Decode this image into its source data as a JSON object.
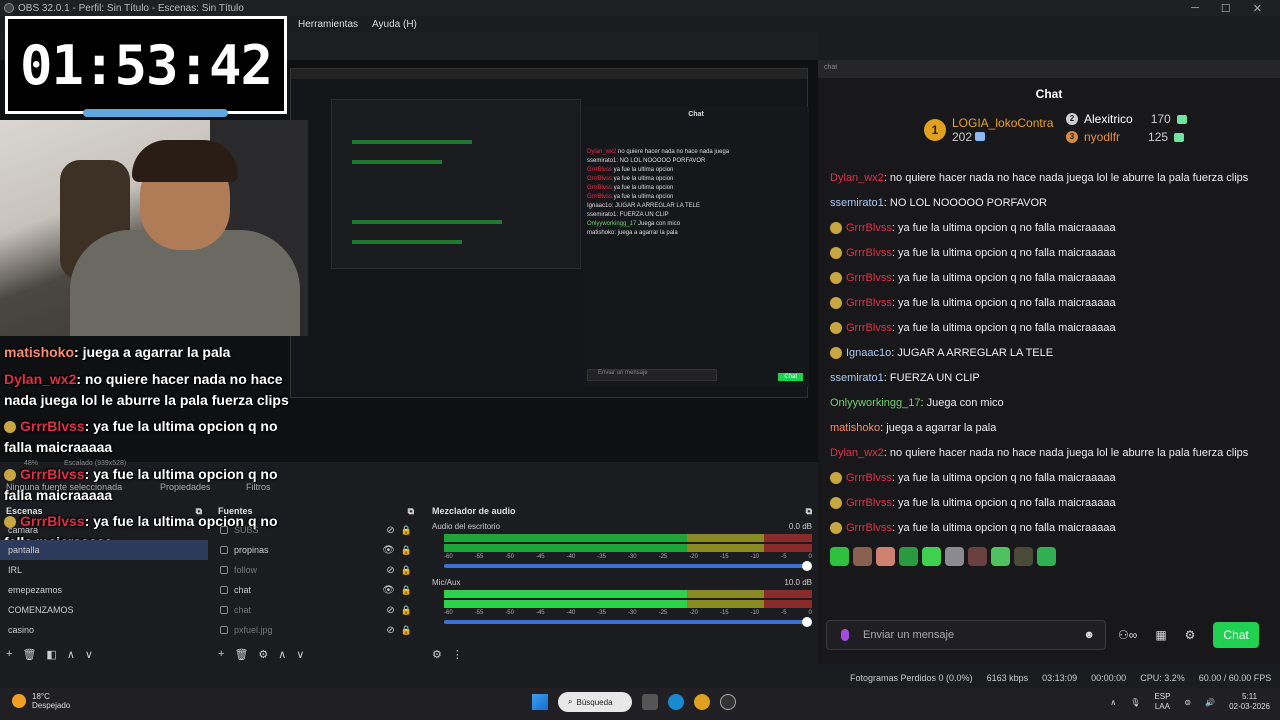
{
  "window": {
    "title": "OBS 32.0.1 - Perfil: Sin Título - Escenas: Sin Título"
  },
  "menu": [
    "Herramientas",
    "Ayuda (H)"
  ],
  "timer": "01:53:42",
  "overlay_chat": [
    {
      "user": "matishoko",
      "text": ": juega a agarrar la pala",
      "color": "#ff8a6a"
    },
    {
      "user": "Dylan_wx2",
      "text": ": no quiere hacer nada no hace nada juega lol le aburre la pala fuerza clips",
      "color": "#e0304a"
    },
    {
      "user": "GrrrBlvss",
      "text": ": ya fue la ultima opcion q no falla maicraaaaa",
      "color": "#e0304a"
    },
    {
      "user": "GrrrBlvss",
      "text": ": ya fue la ultima opcion q no falla maicraaaaa",
      "color": "#e0304a"
    },
    {
      "user": "GrrrBlvss",
      "text": ": ya fue la ultima opcion q no falla maicraaaaa",
      "color": "#e0304a"
    }
  ],
  "status": {
    "no_source": "Ninguna fuente seleccionada",
    "properties": "Propiedades",
    "filters": "Filtros",
    "scale": "Escalado (939x528)",
    "zoom": "48%"
  },
  "scenes": {
    "title": "Escenas",
    "items": [
      "camara",
      "pantalla",
      "IRL",
      "emepezamos",
      "COMENZAMOS",
      "casino"
    ],
    "selected_index": 1
  },
  "sources": {
    "title": "Fuentes",
    "items": [
      {
        "name": "SUBS",
        "visible": false
      },
      {
        "name": "propinas",
        "visible": true
      },
      {
        "name": "follow",
        "visible": false
      },
      {
        "name": "chat",
        "visible": true
      },
      {
        "name": "chat",
        "visible": false
      },
      {
        "name": "pxfuel.jpg",
        "visible": false
      }
    ]
  },
  "mixer": {
    "title": "Mezclador de audio",
    "channels": [
      {
        "name": "Audio del escritorio",
        "db": "0.0 dB",
        "level": 0.0
      },
      {
        "name": "Mic/Aux",
        "db": "10.0 dB",
        "level": 0.72
      }
    ],
    "ticks": [
      "-60",
      "-55",
      "-50",
      "-45",
      "-40",
      "-35",
      "-30",
      "-25",
      "-20",
      "-15",
      "-10",
      "-5",
      "0"
    ]
  },
  "bottom_status": {
    "frames": "Fotogramas Perdidos 0 (0.0%)",
    "kbps": "6163 kbps",
    "rec_time": "03:13:09",
    "stream_time": "00:00:00",
    "cpu": "CPU: 3.2%",
    "fps": "60.00 / 60.00 FPS"
  },
  "chat": {
    "url": "chat",
    "title": "Chat",
    "leaderboard": {
      "first": {
        "name": "LOGIA_lokoContra",
        "points": "202"
      },
      "second": {
        "name": "Alexitrico",
        "points": "170"
      },
      "third": {
        "name": "nyodlfr",
        "points": "125"
      }
    },
    "messages": [
      {
        "user": "Dylan_wx2",
        "text": ": no quiere hacer nada no hace nada juega lol le aburre la pala fuerza clips",
        "color": "#e0304a",
        "badge": false
      },
      {
        "user": "ssemirato1",
        "text": ": NO LOL NOOOOO PORFAVOR",
        "color": "#a9c7f0",
        "badge": false
      },
      {
        "user": "GrrrBlvss",
        "text": ": ya fue la ultima opcion q no falla maicraaaaa",
        "color": "#e0304a",
        "badge": true
      },
      {
        "user": "GrrrBlvss",
        "text": ": ya fue la ultima opcion q no falla maicraaaaa",
        "color": "#e0304a",
        "badge": true
      },
      {
        "user": "GrrrBlvss",
        "text": ": ya fue la ultima opcion q no falla maicraaaaa",
        "color": "#e0304a",
        "badge": true
      },
      {
        "user": "GrrrBlvss",
        "text": ": ya fue la ultima opcion q no falla maicraaaaa",
        "color": "#e0304a",
        "badge": true
      },
      {
        "user": "GrrrBlvss",
        "text": ": ya fue la ultima opcion q no falla maicraaaaa",
        "color": "#e0304a",
        "badge": true
      },
      {
        "user": "Ignaac1o",
        "text": ": JUGAR A ARREGLAR LA TELE",
        "color": "#a9c7f0",
        "badge": true
      },
      {
        "user": "ssemirato1",
        "text": ": FUERZA UN CLIP",
        "color": "#a9c7f0",
        "badge": false
      },
      {
        "user": "Onlyyworkingg_17",
        "text": ": Juega con mico",
        "color": "#6fcf70",
        "badge": false
      },
      {
        "user": "matishoko",
        "text": ": juega a agarrar la pala",
        "color": "#ff8a6a",
        "badge": false
      },
      {
        "user": "Dylan_wx2",
        "text": ": no quiere hacer nada no hace nada juega lol le aburre la pala fuerza clips",
        "color": "#e0304a",
        "badge": false
      },
      {
        "user": "GrrrBlvss",
        "text": ": ya fue la ultima opcion q no falla maicraaaaa",
        "color": "#e0304a",
        "badge": true
      },
      {
        "user": "GrrrBlvss",
        "text": ": ya fue la ultima opcion q no falla maicraaaaa",
        "color": "#e0304a",
        "badge": true
      },
      {
        "user": "GrrrBlvss",
        "text": ": ya fue la ultima opcion q no falla maicraaaaa",
        "color": "#e0304a",
        "badge": true
      }
    ],
    "input_placeholder": "Enviar un mensaje",
    "send_label": "Chat",
    "accent": "#20d050"
  },
  "taskbar": {
    "temp": "18°C",
    "weather": "Despejado",
    "search": "Búsqueda",
    "lang": "ESP",
    "lang2": "LAA",
    "time": "5:11",
    "date": "02-03-2026"
  }
}
